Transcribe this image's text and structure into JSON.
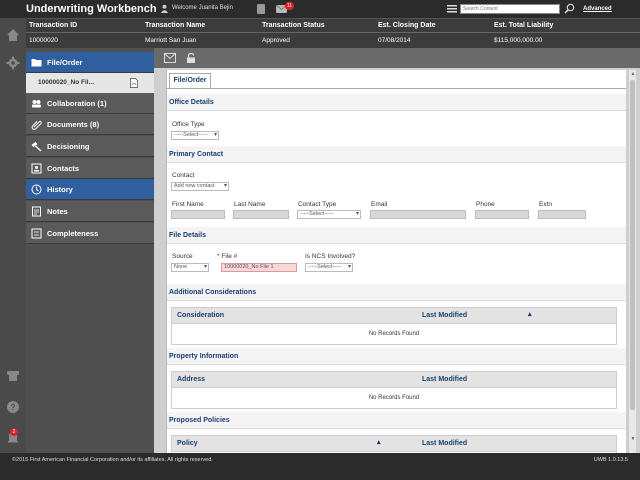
{
  "app": {
    "title": "Underwriting Workbench",
    "welcome": "Welcome Juanita Bejin",
    "mail_count": "11",
    "search_placeholder": "Search Content",
    "advanced": "Advanced"
  },
  "transaction": {
    "labels": [
      "Transaction ID",
      "Transaction Name",
      "Transaction Status",
      "Est. Closing Date",
      "Est. Total Liability"
    ],
    "values": [
      "10000020",
      "Marriott San Juan",
      "Approved",
      "07/08/2014",
      "$115,000,000.00"
    ]
  },
  "rail": {
    "notifications": "2"
  },
  "nav": {
    "file_order": "File/Order",
    "sub_item": "10000020_No Fil...",
    "collaboration": "Collaboration (1)",
    "documents": "Documents (8)",
    "decisioning": "Decisioning",
    "contacts": "Contacts",
    "history": "History",
    "notes": "Notes",
    "completeness": "Completeness"
  },
  "tab": {
    "label": "File/Order"
  },
  "office": {
    "title": "Office Details",
    "type_label": "Office Type",
    "type_value": "-----Select-----"
  },
  "primary": {
    "title": "Primary Contact",
    "contact_label": "Contact",
    "contact_value": "Add new contact",
    "first_name": "First Name",
    "last_name": "Last Name",
    "contact_type": "Contact Type",
    "contact_type_value": "-----Select-----",
    "email": "Email",
    "phone": "Phone",
    "extn": "Extn"
  },
  "file": {
    "title": "File Details",
    "source_label": "Source",
    "source_value": "None",
    "file_label": "File #",
    "file_value": "10000020_No File 1",
    "ncs_label": "Is NCS Involved?",
    "ncs_value": "-----Select-----"
  },
  "additional": {
    "title": "Additional Considerations",
    "col1": "Consideration",
    "col2": "Last Modified",
    "empty": "No Records Found"
  },
  "property": {
    "title": "Property Information",
    "col1": "Address",
    "col2": "Last Modified",
    "empty": "No Records Found"
  },
  "policies": {
    "title": "Proposed Policies",
    "col1": "Policy",
    "col2": "Last Modified"
  },
  "footer": {
    "copyright": "©2015 First American Financial Corporation and/or its affiliates. All rights reserved.",
    "version": "UWB 1.0.13.5"
  }
}
